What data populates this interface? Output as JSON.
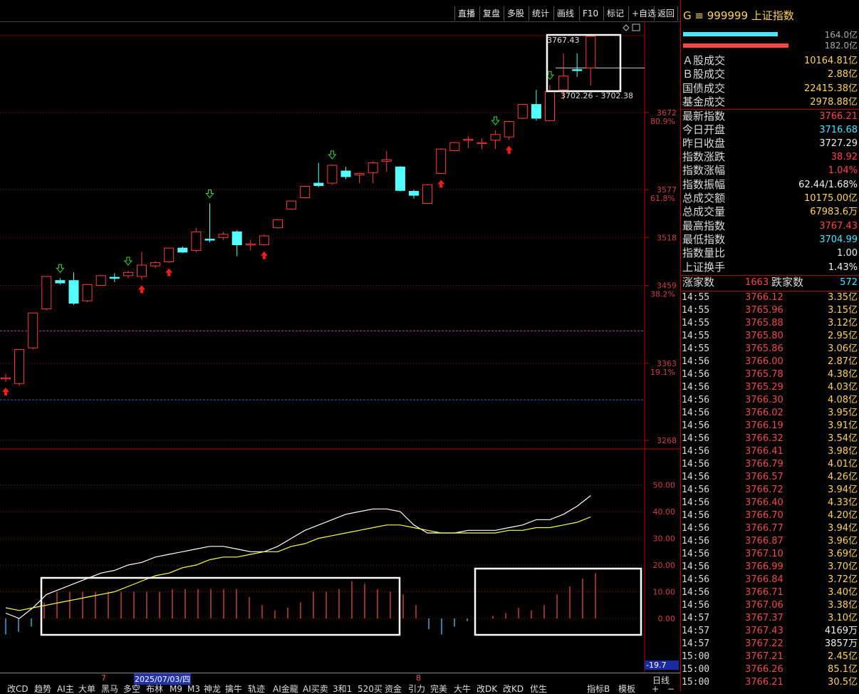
{
  "toolbar": {
    "buttons": [
      "直播",
      "复盘",
      "多股",
      "统计",
      "画线",
      "F10",
      "标记",
      "+自选",
      "返回"
    ]
  },
  "chart": {
    "price_ticks": [
      "3672",
      "3577",
      "3518",
      "3459",
      "3363",
      "3268"
    ],
    "pct_ticks": [
      "80.9%",
      "61.8%",
      "38.2%",
      "19.1%"
    ],
    "high_label": "3767.43",
    "range_label": "3702.26 - 3702.38",
    "ind_ticks": [
      "50.00",
      "40.00",
      "30.00",
      "20.00",
      "10.00",
      "0.00",
      "-19.7"
    ],
    "date_label": "2025/07/03/四",
    "month_labels": [
      "7",
      "8"
    ],
    "period_label": "日线",
    "candles": [
      {
        "o": 3345,
        "c": 3345,
        "h": 3350,
        "l": 3340,
        "up": true
      },
      {
        "o": 3338,
        "c": 3380,
        "h": 3380,
        "l": 3335,
        "up": true
      },
      {
        "o": 3382,
        "c": 3425,
        "h": 3425,
        "l": 3380,
        "up": true
      },
      {
        "o": 3430,
        "c": 3470,
        "h": 3470,
        "l": 3428,
        "up": true
      },
      {
        "o": 3465,
        "c": 3462,
        "h": 3468,
        "l": 3460,
        "up": false
      },
      {
        "o": 3465,
        "c": 3437,
        "h": 3475,
        "l": 3435,
        "up": false
      },
      {
        "o": 3440,
        "c": 3460,
        "h": 3460,
        "l": 3438,
        "up": true
      },
      {
        "o": 3459,
        "c": 3471,
        "h": 3472,
        "l": 3459,
        "up": true
      },
      {
        "o": 3469,
        "c": 3469,
        "h": 3474,
        "l": 3463,
        "up": false
      },
      {
        "o": 3471,
        "c": 3475,
        "h": 3477,
        "l": 3468,
        "up": true
      },
      {
        "o": 3470,
        "c": 3484,
        "h": 3500,
        "l": 3466,
        "up": true
      },
      {
        "o": 3483,
        "c": 3487,
        "h": 3489,
        "l": 3480,
        "up": true
      },
      {
        "o": 3488,
        "c": 3505,
        "h": 3505,
        "l": 3487,
        "up": true
      },
      {
        "o": 3505,
        "c": 3500,
        "h": 3507,
        "l": 3499,
        "up": false
      },
      {
        "o": 3502,
        "c": 3525,
        "h": 3530,
        "l": 3500,
        "up": true
      },
      {
        "o": 3516,
        "c": 3516,
        "h": 3560,
        "l": 3512,
        "up": false
      },
      {
        "o": 3518,
        "c": 3522,
        "h": 3525,
        "l": 3515,
        "up": true
      },
      {
        "o": 3525,
        "c": 3509,
        "h": 3527,
        "l": 3495,
        "up": false
      },
      {
        "o": 3510,
        "c": 3510,
        "h": 3515,
        "l": 3502,
        "up": true
      },
      {
        "o": 3509,
        "c": 3520,
        "h": 3522,
        "l": 3508,
        "up": true
      },
      {
        "o": 3530,
        "c": 3540,
        "h": 3541,
        "l": 3529,
        "up": true
      },
      {
        "o": 3553,
        "c": 3563,
        "h": 3563,
        "l": 3553,
        "up": true
      },
      {
        "o": 3567,
        "c": 3581,
        "h": 3582,
        "l": 3566,
        "up": true
      },
      {
        "o": 3585,
        "c": 3582,
        "h": 3610,
        "l": 3580,
        "up": false
      },
      {
        "o": 3585,
        "c": 3607,
        "h": 3608,
        "l": 3583,
        "up": true
      },
      {
        "o": 3600,
        "c": 3593,
        "h": 3605,
        "l": 3590,
        "up": false
      },
      {
        "o": 3595,
        "c": 3597,
        "h": 3598,
        "l": 3585,
        "up": true
      },
      {
        "o": 3598,
        "c": 3610,
        "h": 3612,
        "l": 3585,
        "up": true
      },
      {
        "o": 3612,
        "c": 3614,
        "h": 3625,
        "l": 3599,
        "up": true
      },
      {
        "o": 3605,
        "c": 3576,
        "h": 3606,
        "l": 3575,
        "up": false
      },
      {
        "o": 3575,
        "c": 3570,
        "h": 3577,
        "l": 3566,
        "up": false
      },
      {
        "o": 3560,
        "c": 3583,
        "h": 3584,
        "l": 3560,
        "up": true
      },
      {
        "o": 3597,
        "c": 3627,
        "h": 3628,
        "l": 3596,
        "up": true
      },
      {
        "o": 3625,
        "c": 3635,
        "h": 3636,
        "l": 3624,
        "up": true
      },
      {
        "o": 3638,
        "c": 3639,
        "h": 3643,
        "l": 3628,
        "up": true
      },
      {
        "o": 3635,
        "c": 3634,
        "h": 3640,
        "l": 3627,
        "up": true
      },
      {
        "o": 3638,
        "c": 3645,
        "h": 3650,
        "l": 3627,
        "up": true
      },
      {
        "o": 3642,
        "c": 3661,
        "h": 3662,
        "l": 3638,
        "up": true
      },
      {
        "o": 3665,
        "c": 3682,
        "h": 3683,
        "l": 3664,
        "up": true
      },
      {
        "o": 3682,
        "c": 3665,
        "h": 3700,
        "l": 3662,
        "up": false
      },
      {
        "o": 3662,
        "c": 3698,
        "h": 3706,
        "l": 3661,
        "up": true
      },
      {
        "o": 3700,
        "c": 3717,
        "h": 3745,
        "l": 3688,
        "up": true
      },
      {
        "o": 3725,
        "c": 3725,
        "h": 3745,
        "l": 3716,
        "up": false
      },
      {
        "o": 3727,
        "c": 3766,
        "h": 3767,
        "l": 3705,
        "up": true
      }
    ],
    "up_arrows": [
      0,
      10,
      12,
      19,
      32,
      37
    ],
    "down_arrows": [
      4,
      9,
      15,
      24,
      36,
      40
    ],
    "line1": [
      12,
      10,
      14,
      19,
      21,
      23,
      25,
      27,
      28,
      30,
      31,
      33,
      34,
      35,
      36,
      37,
      37,
      36,
      35,
      35,
      37,
      40,
      43,
      45,
      47,
      49,
      50,
      51,
      51,
      50,
      45,
      42,
      42,
      42,
      43,
      43,
      43,
      44,
      45,
      47,
      47,
      49,
      52,
      56
    ],
    "line2": [
      14,
      13,
      14,
      15,
      16,
      17,
      18,
      19,
      20,
      22,
      24,
      26,
      27,
      29,
      30,
      32,
      33,
      33,
      34,
      35,
      35,
      37,
      38,
      40,
      41,
      42,
      43,
      44,
      45,
      45,
      44,
      43,
      42,
      42,
      42,
      42,
      42,
      43,
      43,
      44,
      44,
      45,
      46,
      48
    ],
    "hist": [
      -6,
      -5,
      -3,
      6,
      10,
      10,
      10,
      10,
      10,
      10,
      10,
      10,
      10,
      11,
      11,
      11,
      11,
      11,
      11,
      8,
      5,
      3,
      4,
      6,
      10,
      10,
      11,
      14,
      13,
      11,
      10,
      9,
      5,
      -4,
      -6,
      -3,
      -1,
      0,
      1,
      2,
      4,
      3,
      5,
      9,
      12,
      15,
      17
    ]
  },
  "panel": {
    "title": "G ≡ 999999 上证指数",
    "bar_val1": "164.0亿",
    "bar_val2": "182.0亿",
    "stats": [
      {
        "label": "Ａ股成交",
        "value": "10164.81亿",
        "color": "yellow"
      },
      {
        "label": "Ｂ股成交",
        "value": "2.88亿",
        "color": "yellow"
      },
      {
        "label": "国债成交",
        "value": "22415.38亿",
        "color": "yellow"
      },
      {
        "label": "基金成交",
        "value": "2978.88亿",
        "color": "yellow"
      },
      {
        "label": "最新指数",
        "value": "3766.21",
        "color": "red"
      },
      {
        "label": "今日开盘",
        "value": "3716.68",
        "color": "cyan"
      },
      {
        "label": "昨日收盘",
        "value": "3727.29",
        "color": "white"
      },
      {
        "label": "指数涨跌",
        "value": "38.92",
        "color": "red"
      },
      {
        "label": "指数涨幅",
        "value": "1.04%",
        "color": "red"
      },
      {
        "label": "指数振幅",
        "value": "62.44/1.68%",
        "color": "white"
      },
      {
        "label": "总成交额",
        "value": "10175.00亿",
        "color": "yellow"
      },
      {
        "label": "总成交量",
        "value": "67983.6万",
        "color": "yellow"
      },
      {
        "label": "最高指数",
        "value": "3767.43",
        "color": "red"
      },
      {
        "label": "最低指数",
        "value": "3704.99",
        "color": "cyan"
      },
      {
        "label": "指数量比",
        "value": "1.00",
        "color": "white"
      },
      {
        "label": "上证换手",
        "value": "1.43%",
        "color": "white"
      }
    ],
    "rise_label": "涨家数",
    "rise_value": "1663",
    "fall_label": "跌家数",
    "fall_value": "572",
    "ticks": [
      {
        "t": "14:55",
        "p": "3766.12",
        "v": "3.35亿"
      },
      {
        "t": "14:55",
        "p": "3765.96",
        "v": "3.15亿"
      },
      {
        "t": "14:55",
        "p": "3765.88",
        "v": "3.12亿"
      },
      {
        "t": "14:55",
        "p": "3765.80",
        "v": "2.95亿"
      },
      {
        "t": "14:55",
        "p": "3765.86",
        "v": "3.06亿"
      },
      {
        "t": "14:56",
        "p": "3766.00",
        "v": "2.87亿"
      },
      {
        "t": "14:56",
        "p": "3765.78",
        "v": "4.38亿"
      },
      {
        "t": "14:56",
        "p": "3765.29",
        "v": "4.03亿"
      },
      {
        "t": "14:56",
        "p": "3766.30",
        "v": "4.08亿"
      },
      {
        "t": "14:56",
        "p": "3766.02",
        "v": "3.95亿"
      },
      {
        "t": "14:56",
        "p": "3766.19",
        "v": "3.91亿"
      },
      {
        "t": "14:56",
        "p": "3766.32",
        "v": "3.54亿"
      },
      {
        "t": "14:56",
        "p": "3766.41",
        "v": "3.98亿"
      },
      {
        "t": "14:56",
        "p": "3766.79",
        "v": "4.01亿"
      },
      {
        "t": "14:56",
        "p": "3766.57",
        "v": "4.26亿"
      },
      {
        "t": "14:56",
        "p": "3766.72",
        "v": "3.94亿"
      },
      {
        "t": "14:56",
        "p": "3766.40",
        "v": "4.33亿"
      },
      {
        "t": "14:56",
        "p": "3766.70",
        "v": "4.20亿"
      },
      {
        "t": "14:56",
        "p": "3766.77",
        "v": "3.94亿"
      },
      {
        "t": "14:56",
        "p": "3766.87",
        "v": "3.96亿"
      },
      {
        "t": "14:56",
        "p": "3767.10",
        "v": "3.69亿"
      },
      {
        "t": "14:56",
        "p": "3766.99",
        "v": "3.70亿"
      },
      {
        "t": "14:56",
        "p": "3766.84",
        "v": "3.72亿"
      },
      {
        "t": "14:56",
        "p": "3766.71",
        "v": "3.40亿"
      },
      {
        "t": "14:56",
        "p": "3767.06",
        "v": "3.38亿"
      },
      {
        "t": "14:57",
        "p": "3767.37",
        "v": "3.10亿"
      },
      {
        "t": "14:57",
        "p": "3767.43",
        "v": "4169万"
      },
      {
        "t": "14:57",
        "p": "3767.22",
        "v": "3857万"
      },
      {
        "t": "15:00",
        "p": "3767.21",
        "v": "2.45亿"
      },
      {
        "t": "15:00",
        "p": "3766.26",
        "v": "85.1亿"
      },
      {
        "t": "15:00",
        "p": "3766.21",
        "v": "30.5亿"
      }
    ]
  },
  "bottom": {
    "tabs": [
      "改CD",
      "趋势",
      "AI主",
      "大单",
      "黑马",
      "多空",
      "布林",
      "M9",
      "M3",
      "神龙",
      "擒牛",
      "轨迹",
      "AI金龍",
      "AI买卖",
      "3和1",
      "520买",
      "资金",
      "引力",
      "完美",
      "大牛",
      "改DK",
      "改KD",
      "优生"
    ],
    "right_tabs": [
      "指标B",
      "模板"
    ]
  }
}
